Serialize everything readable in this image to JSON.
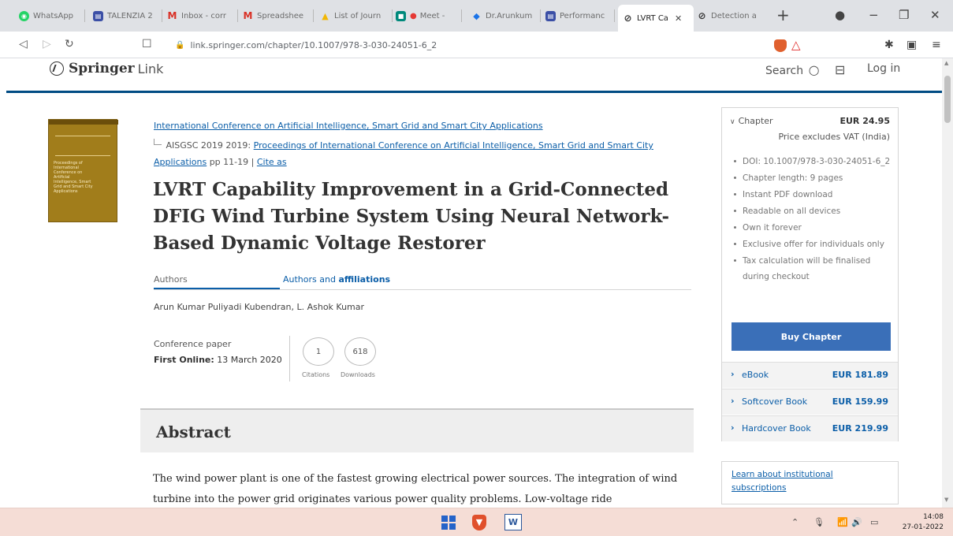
{
  "browser": {
    "tabs": [
      {
        "label": "WhatsApp",
        "color": "#25d366",
        "glyph": "◉"
      },
      {
        "label": "TALENZIA 2",
        "color": "#3b4fa6",
        "glyph": "▤"
      },
      {
        "label": "Inbox - corr",
        "color": "#ffffff",
        "glyph": "M"
      },
      {
        "label": "Spreadshee",
        "color": "#ffffff",
        "glyph": "M"
      },
      {
        "label": "List of Journ",
        "color": "#f2b705",
        "glyph": "▲"
      },
      {
        "label": "Meet - ",
        "color": "#00897b",
        "glyph": "■"
      },
      {
        "label": "Dr.Arunkum",
        "color": "#ffffff",
        "glyph": "◆"
      },
      {
        "label": "Performanc",
        "color": "#3b4fa6",
        "glyph": "▤"
      },
      {
        "label": "LVRT Ca",
        "color": "#ffffff",
        "glyph": "⊘",
        "active": true
      },
      {
        "label": "Detection a",
        "color": "#ffffff",
        "glyph": "⊘"
      }
    ],
    "url": "link.springer.com/chapter/10.1007/978-3-030-24051-6_2"
  },
  "header": {
    "brand": "Springer",
    "brand_suffix": "Link",
    "search_label": "Search",
    "login_label": "Log in"
  },
  "breadcrumb": {
    "series": "International Conference on Artificial Intelligence, Smart Grid and Smart City Applications",
    "prefix": "AISGSC 2019 2019:",
    "proceedings": "Proceedings of International Conference on Artificial Intelligence, Smart Grid and Smart City Applications",
    "pages": "pp 11-19",
    "sep": "|",
    "cite": "Cite as"
  },
  "article": {
    "title": "LVRT Capability Improvement in a Grid-Connected DFIG Wind Turbine System Using Neural Network-Based Dynamic Voltage Restorer",
    "authors_tab": "Authors",
    "affiliations_tab_1": "Authors and ",
    "affiliations_tab_2": "affiliations",
    "authors": "Arun Kumar Puliyadi Kubendran, L. Ashok Kumar",
    "type": "Conference paper",
    "first_online_label": "First Online:",
    "first_online_date": "13 March 2020",
    "citations": "1",
    "citations_label": "Citations",
    "downloads": "618",
    "downloads_label": "Downloads",
    "abstract_heading": "Abstract",
    "abstract_text": "The wind power plant is one of the fastest growing electrical power sources. The integration of wind turbine into the power grid originates various power quality problems. Low-voltage ride"
  },
  "buybox": {
    "chapter_label": "Chapter",
    "price": "EUR 24.95",
    "vat_note": "Price excludes VAT (India)",
    "features": [
      "DOI: 10.1007/978-3-030-24051-6_2",
      "Chapter length: 9 pages",
      "Instant PDF download",
      "Readable on all devices",
      "Own it forever",
      "Exclusive offer for individuals only",
      "Tax calculation will be finalised during checkout"
    ],
    "buy_label": "Buy Chapter",
    "options": [
      {
        "label": "eBook",
        "price": "EUR 181.89"
      },
      {
        "label": "Softcover Book",
        "price": "EUR 159.99"
      },
      {
        "label": "Hardcover Book",
        "price": "EUR 219.99"
      }
    ],
    "institutional": "Learn about institutional subscriptions"
  },
  "cover": {
    "text": "Proceedings of International Conference on Artificial Intelligence, Smart Grid and Smart City Applications"
  },
  "taskbar": {
    "time": "14:08",
    "date": "27-01-2022"
  }
}
